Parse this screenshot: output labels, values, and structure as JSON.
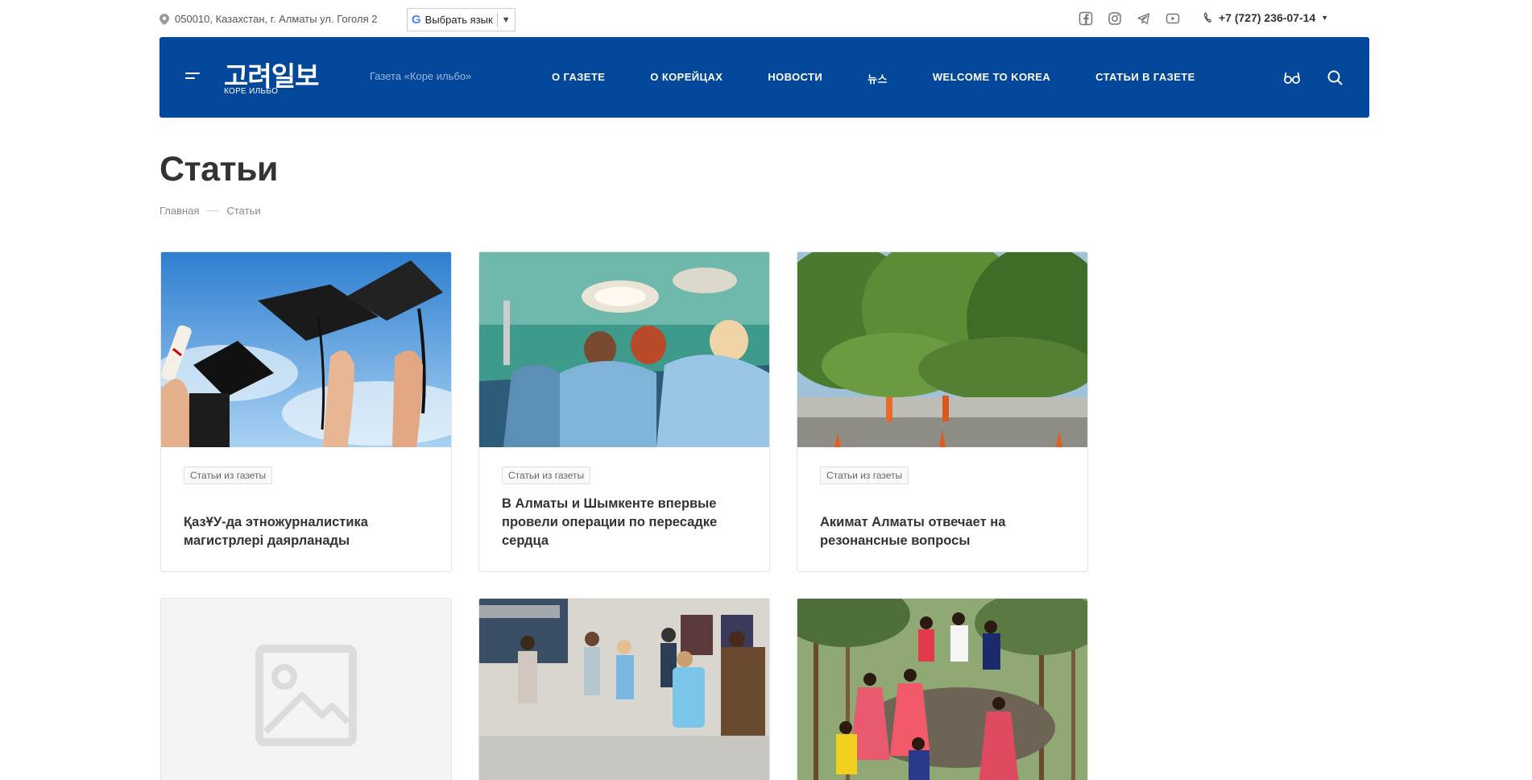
{
  "topbar": {
    "address": "050010, Казахстан, г. Алматы ул. Гоголя 2",
    "language_label": "Выбрать язык",
    "phone": "+7 (727) 236-07-14",
    "social_icons": [
      "facebook-icon",
      "instagram-icon",
      "telegram-icon",
      "youtube-icon"
    ]
  },
  "header": {
    "logo_korean": "고려일보",
    "logo_sub": "КОРЕ ИЛЬБО",
    "tagline": "Газета «Коре ильбо»",
    "nav": [
      "О ГАЗЕТЕ",
      "О КОРЕЙЦАХ",
      "НОВОСТИ",
      "뉴스",
      "WELCOME TO KOREA",
      "СТАТЬИ В ГАЗЕТЕ"
    ],
    "colors": {
      "brand": "#02479a"
    }
  },
  "page": {
    "title": "Статьи",
    "breadcrumb": [
      "Главная",
      "Статьи"
    ]
  },
  "cards": [
    {
      "tag": "Статьи из газеты",
      "title": "ҚазҰУ-да этножурналистика магистрлері даярланады"
    },
    {
      "tag": "Статьи из газеты",
      "title": "В Алматы и Шымкенте впервые провели операции по пересадке сердца"
    },
    {
      "tag": "Статьи из газеты",
      "title": "Акимат Алматы отвечает на резонансные вопросы"
    },
    {
      "tag": "",
      "title": ""
    },
    {
      "tag": "",
      "title": ""
    },
    {
      "tag": "",
      "title": ""
    }
  ]
}
